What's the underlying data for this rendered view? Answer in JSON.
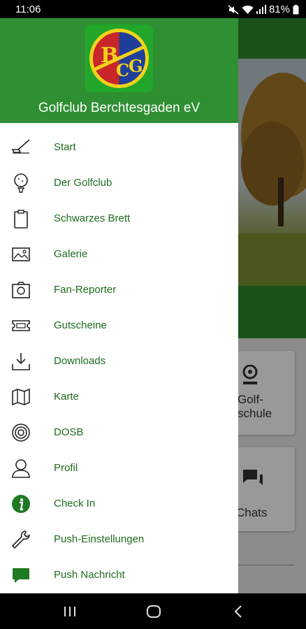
{
  "status_bar": {
    "time": "11:06",
    "battery": "81%"
  },
  "drawer": {
    "club_name": "Golfclub Berchtesgaden eV",
    "menu_items": [
      {
        "label": "Start",
        "icon": "golf-club-icon"
      },
      {
        "label": "Der Golfclub",
        "icon": "golf-ball-tee-icon"
      },
      {
        "label": "Schwarzes Brett",
        "icon": "clipboard-icon"
      },
      {
        "label": "Galerie",
        "icon": "image-gallery-icon"
      },
      {
        "label": "Fan-Reporter",
        "icon": "camera-icon"
      },
      {
        "label": "Gutscheine",
        "icon": "ticket-icon"
      },
      {
        "label": "Downloads",
        "icon": "download-icon"
      },
      {
        "label": "Karte",
        "icon": "map-icon"
      },
      {
        "label": "DOSB",
        "icon": "target-icon"
      },
      {
        "label": "Profil",
        "icon": "user-icon"
      },
      {
        "label": "Check In",
        "icon": "info-icon"
      },
      {
        "label": "Push-Einstellungen",
        "icon": "wrench-icon"
      },
      {
        "label": "Push Nachricht",
        "icon": "chat-bubble-icon"
      }
    ]
  },
  "background": {
    "card_golfschule": "Golf-\nschule",
    "card_chats": "Chats"
  },
  "colors": {
    "brand_green": "#2f8f33",
    "menu_text": "#1e6b1e"
  }
}
